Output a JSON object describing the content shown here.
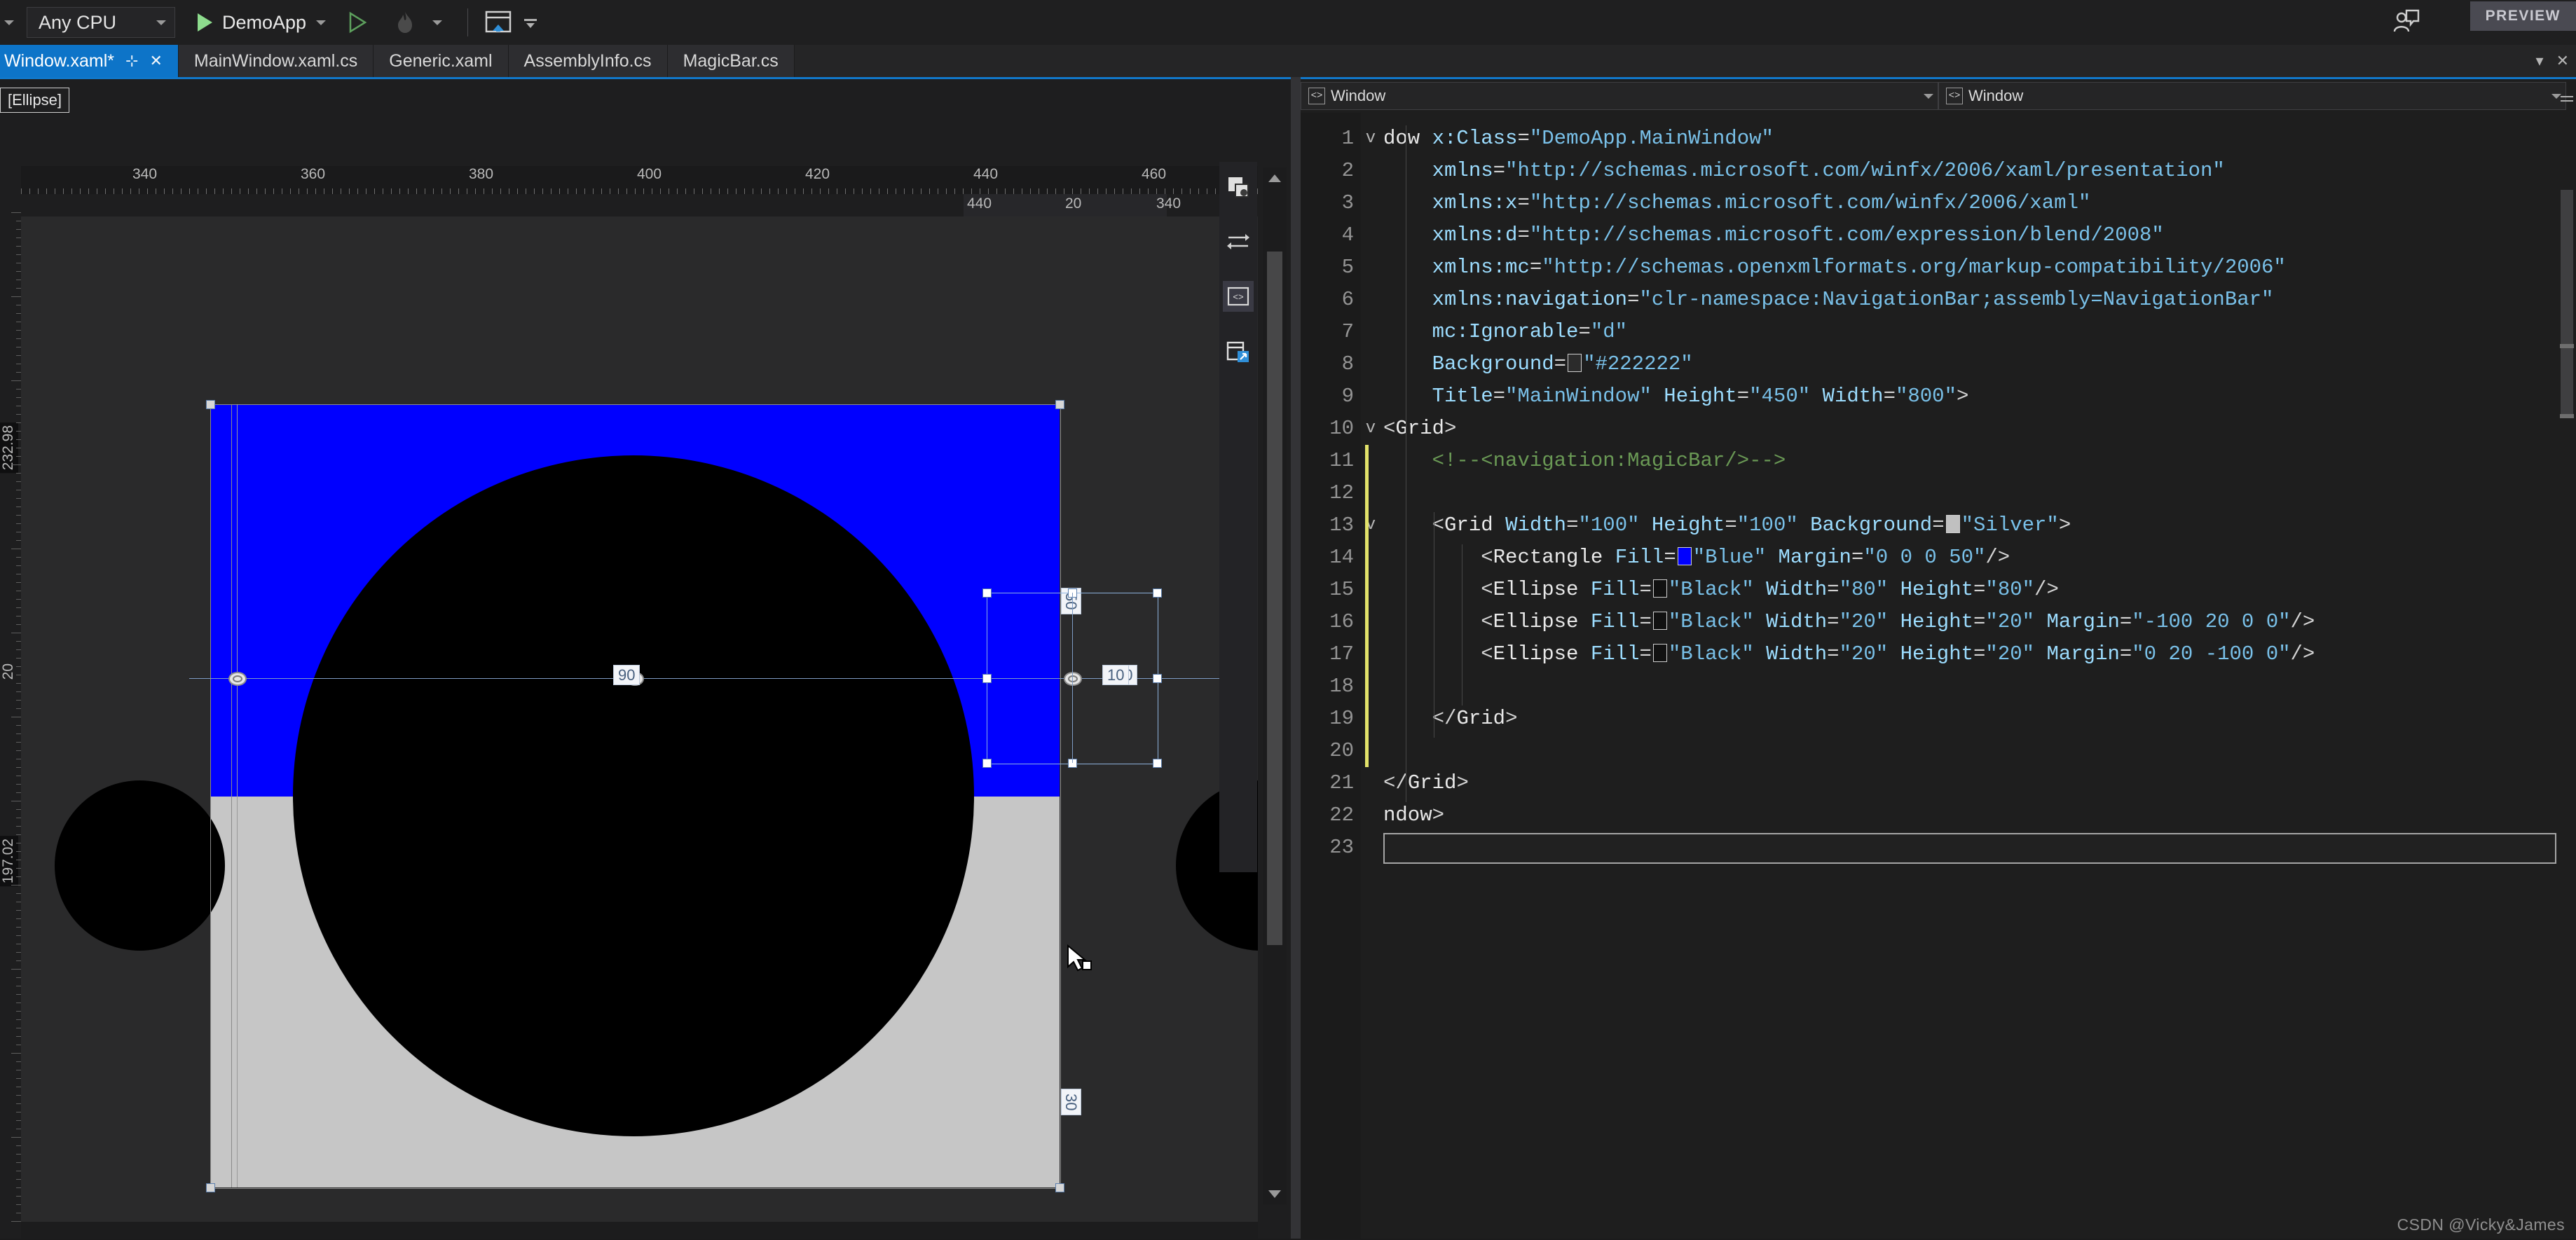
{
  "toolbar": {
    "platform_value": "Any CPU",
    "run_label": "DemoApp",
    "preview_badge": "PREVIEW",
    "icons": {
      "start_debug": "play-triangle-icon",
      "start_no_debug": "play-outline-icon",
      "hot_reload": "flame-icon",
      "live_visual_tree": "window-home-icon",
      "overflow": "toolbar-overflow-icon",
      "feedback": "feedback-person-icon"
    }
  },
  "tabs": [
    {
      "label": "Window.xaml*",
      "active": true,
      "pin": "⊹",
      "close": "✕"
    },
    {
      "label": "MainWindow.xaml.cs",
      "active": false
    },
    {
      "label": "Generic.xaml",
      "active": false
    },
    {
      "label": "AssemblyInfo.cs",
      "active": false
    },
    {
      "label": "MagicBar.cs",
      "active": false
    }
  ],
  "designer": {
    "element_badge": "[Ellipse]",
    "h_ruler_labels": [
      "340",
      "360",
      "380",
      "400",
      "420",
      "440",
      "460"
    ],
    "h_ruler2_labels": [
      "440",
      "20",
      "340"
    ],
    "v_ruler_labels": [
      "232.98",
      "20",
      "197.02"
    ],
    "adorner_labels": {
      "right_margin_top": "50",
      "right_margin_bottom": "30",
      "center_left": "90",
      "center_mid": "90",
      "selected_right": "10"
    },
    "shapes": {
      "window_background": "#222222",
      "grid_background": "Silver",
      "rect_fill": "Blue",
      "ellipse_fill": "Black"
    },
    "rail_icons": [
      "artboard-icon",
      "swap-arrows-icon",
      "xaml-code-icon",
      "pop-out-window-icon"
    ],
    "cursor": "arrow-with-square-cursor"
  },
  "editor": {
    "nav_left": "Window",
    "nav_right": "Window",
    "nav_icon": "code-brackets-icon",
    "lines": [
      {
        "n": "1",
        "fold": "v",
        "html": "<span class=\"t-tag\">dow</span> <span class=\"t-attr\">x:Class</span><span class=\"t-eq\">=</span><span class=\"t-str\">\"DemoApp.MainWindow\"</span>"
      },
      {
        "n": "2",
        "fold": "",
        "html": "    <span class=\"t-attr\">xmlns</span><span class=\"t-eq\">=</span><span class=\"t-str\">\"http://schemas.microsoft.com/winfx/2006/xaml/presentation\"</span>"
      },
      {
        "n": "3",
        "fold": "",
        "html": "    <span class=\"t-attr\">xmlns:x</span><span class=\"t-eq\">=</span><span class=\"t-str\">\"http://schemas.microsoft.com/winfx/2006/xaml\"</span>"
      },
      {
        "n": "4",
        "fold": "",
        "html": "    <span class=\"t-attr\">xmlns:d</span><span class=\"t-eq\">=</span><span class=\"t-str\">\"http://schemas.microsoft.com/expression/blend/2008\"</span>"
      },
      {
        "n": "5",
        "fold": "",
        "html": "    <span class=\"t-attr\">xmlns:mc</span><span class=\"t-eq\">=</span><span class=\"t-str\">\"http://schemas.openxmlformats.org/markup-compatibility/2006\"</span>"
      },
      {
        "n": "6",
        "fold": "",
        "html": "    <span class=\"t-attr\">xmlns:navigation</span><span class=\"t-eq\">=</span><span class=\"t-str\">\"clr-namespace:NavigationBar;assembly=NavigationBar\"</span>"
      },
      {
        "n": "7",
        "fold": "",
        "html": "    <span class=\"t-attr\">mc:Ignorable</span><span class=\"t-eq\">=</span><span class=\"t-str\">\"d\"</span>"
      },
      {
        "n": "8",
        "fold": "",
        "html": "    <span class=\"t-attr\">Background</span><span class=\"t-eq\">=</span><span class=\"swatch sw-dark\"></span><span class=\"t-str\">\"#222222\"</span>"
      },
      {
        "n": "9",
        "fold": "",
        "html": "    <span class=\"t-attr\">Title</span><span class=\"t-eq\">=</span><span class=\"t-str\">\"MainWindow\"</span> <span class=\"t-attr\">Height</span><span class=\"t-eq\">=</span><span class=\"t-str\">\"450\"</span> <span class=\"t-attr\">Width</span><span class=\"t-eq\">=</span><span class=\"t-str\">\"800\"</span><span class=\"t-br\">&gt;</span>"
      },
      {
        "n": "10",
        "fold": "v",
        "html": "<span class=\"t-br\">&lt;</span><span class=\"t-tag\">Grid</span><span class=\"t-br\">&gt;</span>"
      },
      {
        "n": "11",
        "fold": "",
        "html": "    <span class=\"t-cmt\">&lt;!--&lt;navigation:MagicBar/&gt;--&gt;</span>"
      },
      {
        "n": "12",
        "fold": "",
        "html": ""
      },
      {
        "n": "13",
        "fold": "v",
        "html": "    <span class=\"t-br\">&lt;</span><span class=\"t-tag\">Grid</span> <span class=\"t-attr\">Width</span><span class=\"t-eq\">=</span><span class=\"t-str\">\"100\"</span> <span class=\"t-attr\">Height</span><span class=\"t-eq\">=</span><span class=\"t-str\">\"100\"</span> <span class=\"t-attr\">Background</span><span class=\"t-eq\">=</span><span class=\"swatch sw-silver\"></span><span class=\"t-str\">\"Silver\"</span><span class=\"t-br\">&gt;</span>"
      },
      {
        "n": "14",
        "fold": "",
        "html": "        <span class=\"t-br\">&lt;</span><span class=\"t-tag\">Rectangle</span> <span class=\"t-attr\">Fill</span><span class=\"t-eq\">=</span><span class=\"swatch sw-blue\"></span><span class=\"t-str\">\"Blue\"</span> <span class=\"t-attr\">Margin</span><span class=\"t-eq\">=</span><span class=\"t-str\">\"0 0 0 50\"</span><span class=\"t-br\">/&gt;</span>"
      },
      {
        "n": "15",
        "fold": "",
        "html": "        <span class=\"t-br\">&lt;</span><span class=\"t-tag\">Ellipse</span> <span class=\"t-attr\">Fill</span><span class=\"t-eq\">=</span><span class=\"swatch sw-black\"></span><span class=\"t-str\">\"Black\"</span> <span class=\"t-attr\">Width</span><span class=\"t-eq\">=</span><span class=\"t-str\">\"80\"</span> <span class=\"t-attr\">Height</span><span class=\"t-eq\">=</span><span class=\"t-str\">\"80\"</span><span class=\"t-br\">/&gt;</span>"
      },
      {
        "n": "16",
        "fold": "",
        "html": "        <span class=\"t-br\">&lt;</span><span class=\"t-tag\">Ellipse</span> <span class=\"t-attr\">Fill</span><span class=\"t-eq\">=</span><span class=\"swatch sw-black\"></span><span class=\"t-str\">\"Black\"</span> <span class=\"t-attr\">Width</span><span class=\"t-eq\">=</span><span class=\"t-str\">\"20\"</span> <span class=\"t-attr\">Height</span><span class=\"t-eq\">=</span><span class=\"t-str\">\"20\"</span> <span class=\"t-attr\">Margin</span><span class=\"t-eq\">=</span><span class=\"t-str\">\"-100 20 0 0\"</span><span class=\"t-br\">/&gt;</span>"
      },
      {
        "n": "17",
        "fold": "",
        "html": "        <span class=\"t-br\">&lt;</span><span class=\"t-tag\">Ellipse</span> <span class=\"t-attr\">Fill</span><span class=\"t-eq\">=</span><span class=\"swatch sw-black\"></span><span class=\"t-str\">\"Black\"</span> <span class=\"t-attr\">Width</span><span class=\"t-eq\">=</span><span class=\"t-str\">\"20\"</span> <span class=\"t-attr\">Height</span><span class=\"t-eq\">=</span><span class=\"t-str\">\"20\"</span> <span class=\"t-attr\">Margin</span><span class=\"t-eq\">=</span><span class=\"t-str\">\"0 20 -100 0\"</span><span class=\"t-br\">/&gt;</span>"
      },
      {
        "n": "18",
        "fold": "",
        "html": ""
      },
      {
        "n": "19",
        "fold": "",
        "html": "    <span class=\"t-br\">&lt;/</span><span class=\"t-tag\">Grid</span><span class=\"t-br\">&gt;</span>"
      },
      {
        "n": "20",
        "fold": "",
        "html": ""
      },
      {
        "n": "21",
        "fold": "",
        "html": "<span class=\"t-br\">&lt;/</span><span class=\"t-tag\">Grid</span><span class=\"t-br\">&gt;</span>"
      },
      {
        "n": "22",
        "fold": "",
        "html": "<span class=\"t-tag\">ndow</span><span class=\"t-br\">&gt;</span>"
      },
      {
        "n": "23",
        "fold": "",
        "html": ""
      }
    ]
  },
  "watermark": "CSDN @Vicky&James"
}
